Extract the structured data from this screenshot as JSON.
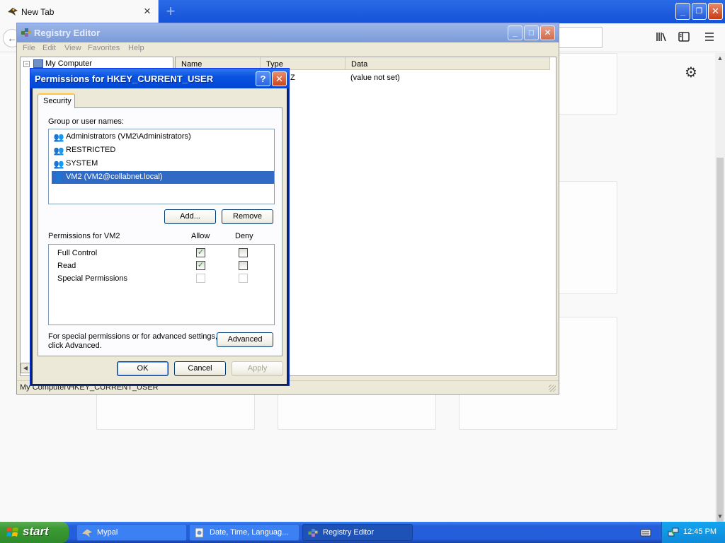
{
  "browser": {
    "tab_title": "New Tab",
    "tab_close": "×",
    "new_tab": "+",
    "window_buttons": {
      "minimize": "_",
      "restore": "❐",
      "close": "✕"
    },
    "toolbar": {
      "library_icon": "library-icon",
      "sidebar_icon": "sidebar-icon",
      "menu_icon": "hamburger-menu-icon"
    },
    "settings_icon": "gear-icon"
  },
  "registry_editor": {
    "title": "Registry Editor",
    "menu": [
      "File",
      "Edit",
      "View",
      "Favorites",
      "Help"
    ],
    "tree_root": "My Computer",
    "columns": [
      "Name",
      "Type",
      "Data"
    ],
    "values": [
      {
        "type_fragment": "Z",
        "data": "(value not set)"
      }
    ],
    "status": "My Computer\\HKEY_CURRENT_USER"
  },
  "permissions_dialog": {
    "title": "Permissions for HKEY_CURRENT_USER",
    "help_button": "?",
    "close_button": "✕",
    "tab": "Security",
    "group_label": "Group or user names:",
    "users": [
      {
        "name": "Administrators (VM2\\Administrators)",
        "selected": false
      },
      {
        "name": "RESTRICTED",
        "selected": false
      },
      {
        "name": "SYSTEM",
        "selected": false
      },
      {
        "name": "VM2 (VM2@collabnet.local)",
        "selected": true
      }
    ],
    "add_button": "Add...",
    "remove_button": "Remove",
    "permissions_label": "Permissions for VM2",
    "allow_label": "Allow",
    "deny_label": "Deny",
    "permissions": [
      {
        "name": "Full Control",
        "allow": true,
        "deny": false,
        "enabled": true
      },
      {
        "name": "Read",
        "allow": true,
        "deny": false,
        "enabled": true
      },
      {
        "name": "Special Permissions",
        "allow": false,
        "deny": false,
        "enabled": false
      }
    ],
    "advanced_text_1": "For special permissions or for advanced settings,",
    "advanced_text_2": "click Advanced.",
    "advanced_button": "Advanced",
    "ok_button": "OK",
    "cancel_button": "Cancel",
    "apply_button": "Apply"
  },
  "taskbar": {
    "start": "start",
    "tasks": [
      {
        "label": "Mypal",
        "active": false
      },
      {
        "label": "Date, Time, Languag...",
        "active": false
      },
      {
        "label": "Registry Editor",
        "active": true
      }
    ],
    "clock": "12:45 PM"
  },
  "colors": {
    "xp_blue": "#0a246a",
    "selection": "#316ac5",
    "taskbar": "#245edb",
    "start_green": "#3c9b35"
  }
}
